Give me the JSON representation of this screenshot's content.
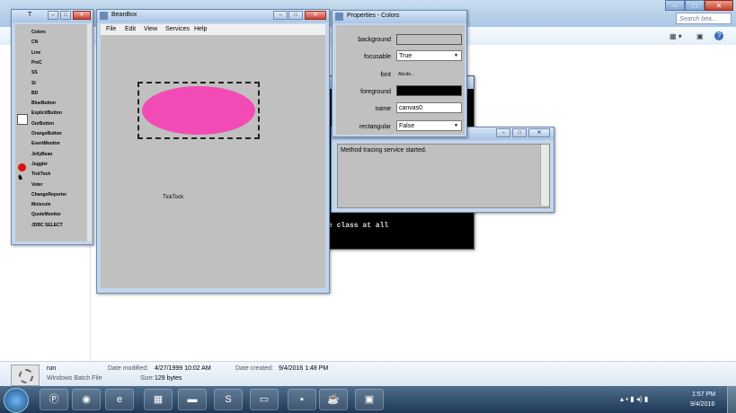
{
  "explorer": {
    "search_placeholder": "Search bea...",
    "details": {
      "file_name": "run",
      "file_type": "Windows Batch File",
      "date_modified_label": "Date modified:",
      "date_modified": "4/27/1999 10:02 AM",
      "date_created_label": "Date created:",
      "date_created": "9/4/2016 1:48 PM",
      "size_label": "Size:",
      "size": "129 bytes"
    }
  },
  "toolbox": {
    "title": "T",
    "items": [
      "Colors",
      "CN",
      "Line",
      "PreC",
      "SS",
      "SI",
      "BD",
      "BlueButton",
      "ExplicitButton",
      "OurButton",
      "OrangeButton",
      "EventMonitor",
      "JellyBean",
      "Juggler",
      "TickTock",
      "Voter",
      "ChangeReporter",
      "Molecule",
      "QuoteMonitor",
      "JDBC SELECT"
    ]
  },
  "beanbox": {
    "title": "BeanBox",
    "menu": [
      "File",
      "Edit",
      "View",
      "Services",
      "Help"
    ],
    "canvas_label": "TickTock",
    "colors": {
      "ellipse": "#f24bb6"
    }
  },
  "properties": {
    "title": "Properties - Colors",
    "rows": [
      {
        "label": "background",
        "value": ""
      },
      {
        "label": "focusable",
        "value": "True"
      },
      {
        "label": "font",
        "value": "Abcde..."
      },
      {
        "label": "foreground",
        "value": ""
      },
      {
        "label": "name",
        "value": "canvas0"
      },
      {
        "label": "rectangular",
        "value": "False"
      }
    ]
  },
  "method_tracer": {
    "message": "Method tracing service started."
  },
  "console": {
    "text": "e class at all"
  },
  "tray": {
    "time": "1:57 PM",
    "date": "9/4/2016"
  }
}
